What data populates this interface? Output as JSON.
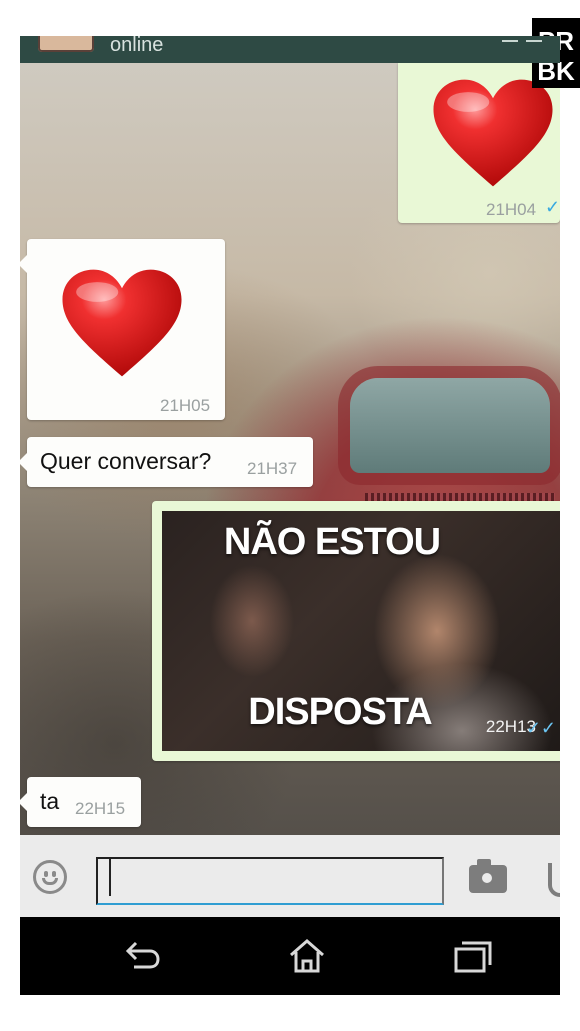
{
  "header": {
    "status": "online"
  },
  "messages": [
    {
      "type": "emoji",
      "direction": "out",
      "emoji": "heart",
      "time": "21H04",
      "read": true
    },
    {
      "type": "emoji",
      "direction": "in",
      "emoji": "heart",
      "time": "21H05"
    },
    {
      "type": "text",
      "direction": "in",
      "text": "Quer conversar?",
      "time": "21H37"
    },
    {
      "type": "image",
      "direction": "out",
      "caption_top": "NÃO ESTOU",
      "caption_bottom": "DISPOSTA",
      "time": "22H13",
      "read": true
    },
    {
      "type": "text",
      "direction": "in",
      "text": "ta",
      "time": "22H15"
    }
  ],
  "input": {
    "value": "",
    "placeholder": ""
  },
  "icons": {
    "emoji": "smiley-icon",
    "camera": "camera-icon",
    "mic": "microphone-icon",
    "back": "back-icon",
    "home": "home-icon",
    "recents": "recent-apps-icon"
  },
  "watermark": "PR BK",
  "colors": {
    "header": "#2e4a44",
    "incoming_bubble": "#fdfdfb",
    "outgoing_bubble": "#e9f8d6",
    "read_tick": "#38a9e0",
    "input_underline": "#2f9dd2"
  }
}
